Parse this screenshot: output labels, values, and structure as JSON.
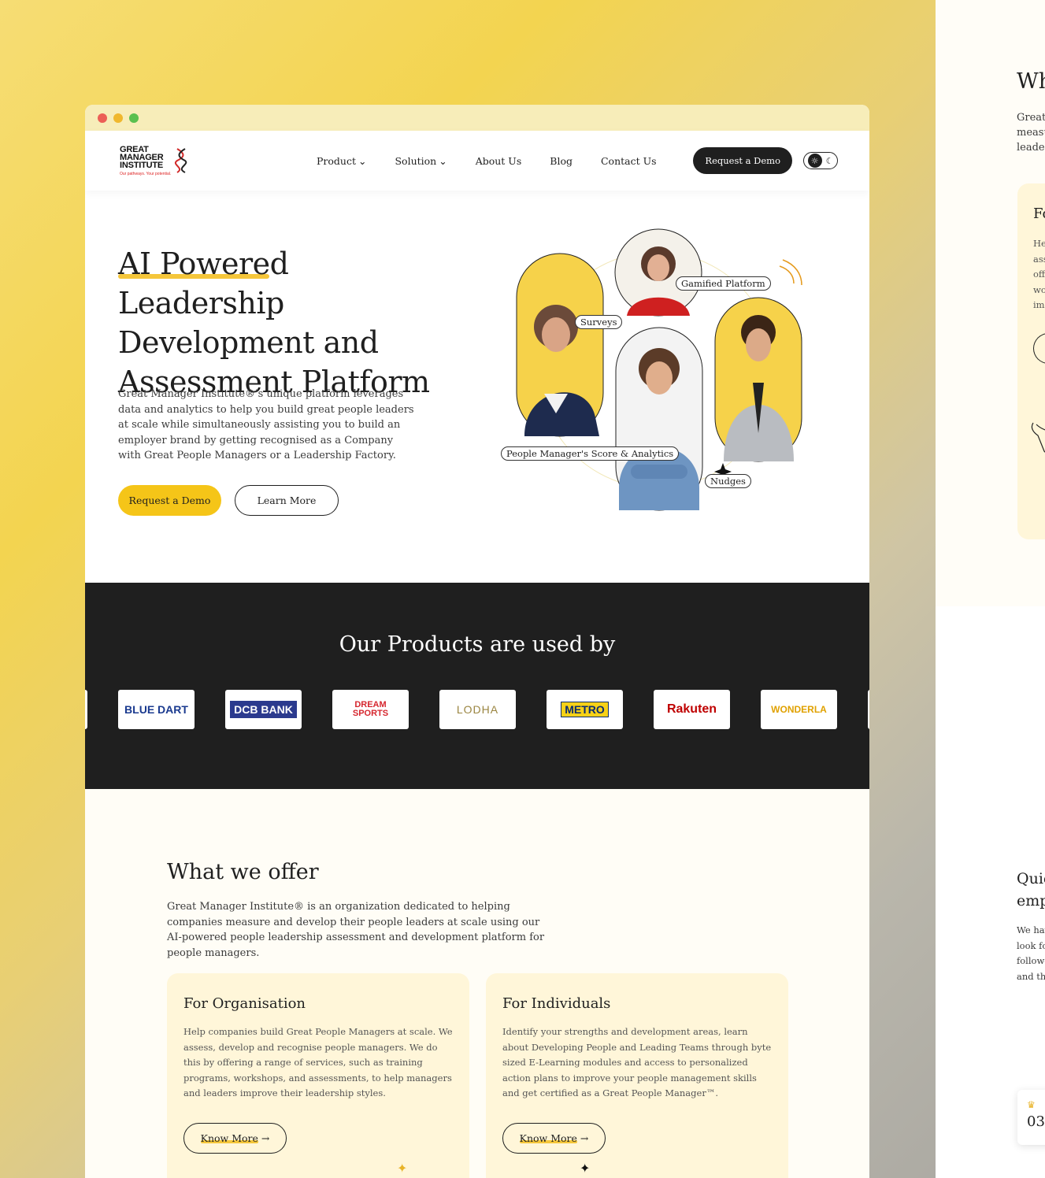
{
  "nav": {
    "logo_line1": "GREAT",
    "logo_line2": "MANAGER",
    "logo_line3": "INSTITUTE",
    "logo_tagline": "Our pathways. Your potential.",
    "items": [
      {
        "label": "Product",
        "has_dropdown": true
      },
      {
        "label": "Solution",
        "has_dropdown": true
      },
      {
        "label": "About Us",
        "has_dropdown": false
      },
      {
        "label": "Blog",
        "has_dropdown": false
      },
      {
        "label": "Contact Us",
        "has_dropdown": false
      }
    ],
    "cta": "Request a Demo",
    "theme_toggle": {
      "light_icon": "sun-icon",
      "dark_icon": "moon-icon",
      "selected": "light"
    }
  },
  "hero": {
    "title_highlight": "AI Powered",
    "title_rest": " Leadership Development and Assessment Platform",
    "description": "Great Manager Institute®'s unique platform leverages data and analytics to help you build great people leaders at scale while simultaneously assisting you to build an employer brand by getting recognised as a Company with Great People Managers or a Leadership Factory.",
    "primary_button": "Request a Demo",
    "secondary_button": "Learn More",
    "badges": {
      "surveys": "Surveys",
      "gamified": "Gamified Platform",
      "score": "People Manager's Score & Analytics",
      "nudges": "Nudges"
    }
  },
  "clients": {
    "heading": "Our Products are used by",
    "logos": [
      {
        "name": "BLUE DART",
        "color": "#1a3a8f"
      },
      {
        "name": "DCB BANK",
        "color": "#ffffff",
        "bg": "#2b3a8e"
      },
      {
        "name": "DREAM SPORTS",
        "color": "#d6262e"
      },
      {
        "name": "LODHA",
        "color": "#9a8540"
      },
      {
        "name": "METRO",
        "color": "#0b2c6f",
        "bg": "#f7d117"
      },
      {
        "name": "Rakuten",
        "color": "#bf0000"
      },
      {
        "name": "WONDERLA",
        "color": "#e0a100"
      }
    ]
  },
  "offer": {
    "heading": "What we offer",
    "lead": "Great Manager Institute® is an organization dedicated to helping companies measure and develop their people leaders at scale using our AI-powered people leadership assessment and development platform for people managers.",
    "cards": [
      {
        "title": "For Organisation",
        "body": "Help companies build Great People Managers at scale. We assess, develop and recognise people managers. We do this by offering a range of services, such as training programs, workshops, and assessments, to help managers and leaders improve their leadership styles.",
        "button": "Know More"
      },
      {
        "title": "For Individuals",
        "body": "Identify your strengths and development areas, learn about Developing People and Leading Teams through byte sized E-Learning modules and access to personalized action plans to improve your people management skills and get certified as a Great People Manager™.",
        "button": "Know More"
      }
    ]
  },
  "peek": {
    "title": "Wh",
    "lines_top": [
      "Great",
      "measu",
      "leader"
    ],
    "card_title": "Fo",
    "card_lines": [
      "He",
      "ass",
      "off",
      "wo",
      "im"
    ],
    "lower_title_1": "Quic",
    "lower_title_2": "emp",
    "lower_lines": [
      "We hav",
      "look fo",
      "follow-",
      "and th"
    ],
    "counter": "03"
  },
  "colors": {
    "accent": "#f5c518",
    "dark": "#1f1f1f",
    "card_bg": "#fff6d9"
  }
}
